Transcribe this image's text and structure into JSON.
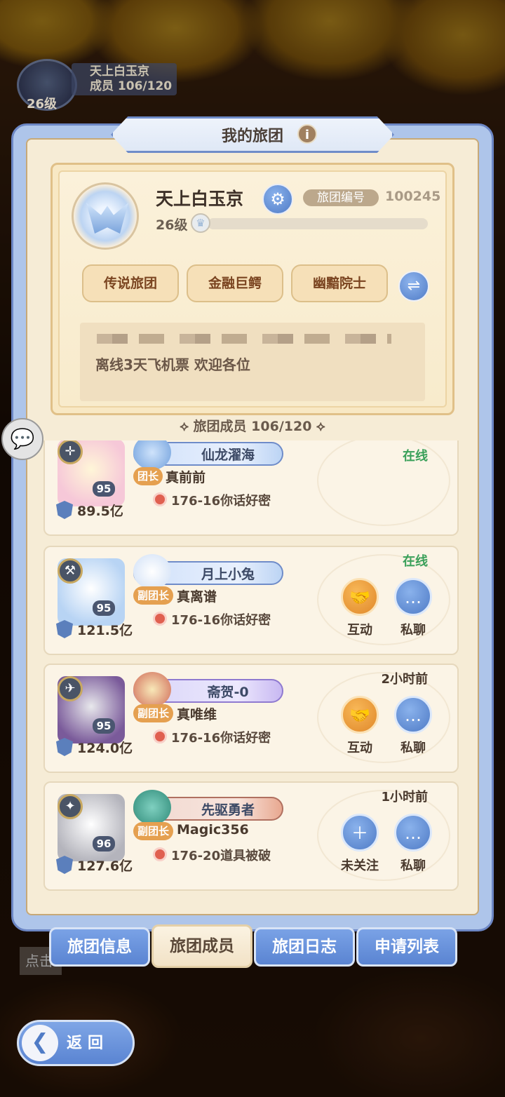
{
  "guild_header": {
    "level": "26级",
    "name": "天上白玉京",
    "members": "成员 106/120"
  },
  "panel": {
    "title": "我的旅团",
    "info_icon": "i"
  },
  "guild": {
    "name": "天上白玉京",
    "id_label": "旅团编号",
    "id": "100245",
    "level": "26级",
    "level_progress": 0.0,
    "tags": [
      "传说旅团",
      "金融巨鳄",
      "幽黯院士"
    ],
    "notice": "离线3天飞机票 欢迎各位"
  },
  "members_label": "旅团成员 106/120",
  "members": [
    {
      "title": "仙龙濯海",
      "role": "团长",
      "name": "真前前",
      "level": "95",
      "power": "89.5亿",
      "location": "176-16你话好密",
      "status": "在线",
      "actions": []
    },
    {
      "title": "月上小兔",
      "role": "副团长",
      "name": "真离谱",
      "level": "95",
      "power": "121.5亿",
      "location": "176-16你话好密",
      "status": "在线",
      "actions": [
        "互动",
        "私聊"
      ]
    },
    {
      "title": "斋贺-0",
      "role": "副团长",
      "name": "真唯维",
      "level": "95",
      "power": "124.0亿",
      "location": "176-16你话好密",
      "status": "2小时前",
      "actions": [
        "互动",
        "私聊"
      ]
    },
    {
      "title": "先驱勇者",
      "role": "副团长",
      "name": "Magic356",
      "level": "96",
      "power": "127.6亿",
      "location": "176-20道具被破",
      "status": "1小时前",
      "actions": [
        "未关注",
        "私聊"
      ]
    }
  ],
  "tabs": [
    "旅团信息",
    "旅团成员",
    "旅团日志",
    "申请列表"
  ],
  "active_tab": "旅团成员",
  "back_label": "返回",
  "colors": {
    "online": "#3aa05a",
    "tab_blue": "#5a84d2",
    "accent_orange": "#e0882a"
  }
}
